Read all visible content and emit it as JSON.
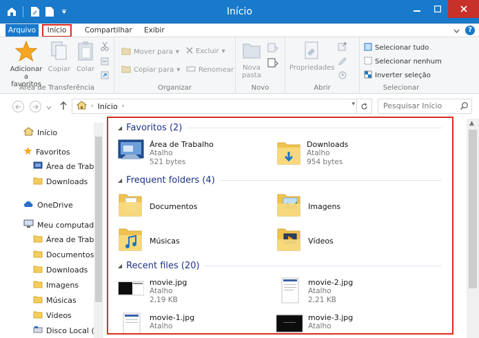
{
  "window": {
    "title": "Início"
  },
  "ribbon": {
    "tabs": {
      "file": "Arquivo",
      "home": "Início",
      "share": "Compartilhar",
      "view": "Exibir"
    },
    "groups": {
      "clipboard": {
        "label": "Área de Transferência",
        "add_favorites": [
          "Adicionar",
          "a favoritos"
        ],
        "copy": "Copiar",
        "paste": "Colar"
      },
      "organize": {
        "label": "Organizar",
        "move_to": "Mover para",
        "copy_to": "Copiar para",
        "delete": "Excluir",
        "rename": "Renomear"
      },
      "new": {
        "label": "Novo",
        "new_folder": [
          "Nova",
          "pasta"
        ]
      },
      "open": {
        "label": "Abrir",
        "properties": "Propriedades"
      },
      "select": {
        "label": "Selecionar",
        "select_all": "Selecionar tudo",
        "select_none": "Selecionar nenhum",
        "invert": "Inverter seleção"
      }
    }
  },
  "address": {
    "crumb": "Início",
    "search_placeholder": "Pesquisar Início"
  },
  "nav": {
    "items": [
      {
        "label": "Início",
        "icon": "home-icon"
      },
      {
        "label": "Favoritos",
        "icon": "star-icon"
      },
      {
        "label": "Área de Trabal",
        "icon": "desktop-icon"
      },
      {
        "label": "Downloads",
        "icon": "folder-icon"
      },
      {
        "label": "OneDrive",
        "icon": "cloud-icon"
      },
      {
        "label": "Meu computador",
        "icon": "computer-icon"
      },
      {
        "label": "Área de Trabal",
        "icon": "folder-icon"
      },
      {
        "label": "Documentos",
        "icon": "folder-icon"
      },
      {
        "label": "Downloads",
        "icon": "folder-icon"
      },
      {
        "label": "Imagens",
        "icon": "folder-icon"
      },
      {
        "label": "Músicas",
        "icon": "folder-icon"
      },
      {
        "label": "Vídeos",
        "icon": "folder-icon"
      },
      {
        "label": "Disco Local (C",
        "icon": "drive-icon"
      }
    ]
  },
  "content": {
    "favorites": {
      "label": "Favoritos (2)",
      "items": [
        {
          "name": "Área de Trabalho",
          "type": "Atalho",
          "size": "521 bytes"
        },
        {
          "name": "Downloads",
          "type": "Atalho",
          "size": "954 bytes"
        }
      ]
    },
    "frequent": {
      "label": "Frequent folders (4)",
      "items": [
        {
          "name": "Documentos"
        },
        {
          "name": "Imagens"
        },
        {
          "name": "Músicas"
        },
        {
          "name": "Vídeos"
        }
      ]
    },
    "recent": {
      "label": "Recent files (20)",
      "items": [
        {
          "name": "movie.jpg",
          "type": "Atalho",
          "size": "2,19 KB"
        },
        {
          "name": "movie-2.jpg",
          "type": "Atalho",
          "size": "2,21 KB"
        },
        {
          "name": "movie-1.jpg",
          "type": "Atalho",
          "size": ""
        },
        {
          "name": "movie-3.jpg",
          "type": "Atalho",
          "size": ""
        }
      ]
    }
  },
  "colors": {
    "accent": "#1979ca",
    "highlight": "#d92d1c",
    "section": "#1e3287",
    "folder": "#f3cd5e"
  }
}
